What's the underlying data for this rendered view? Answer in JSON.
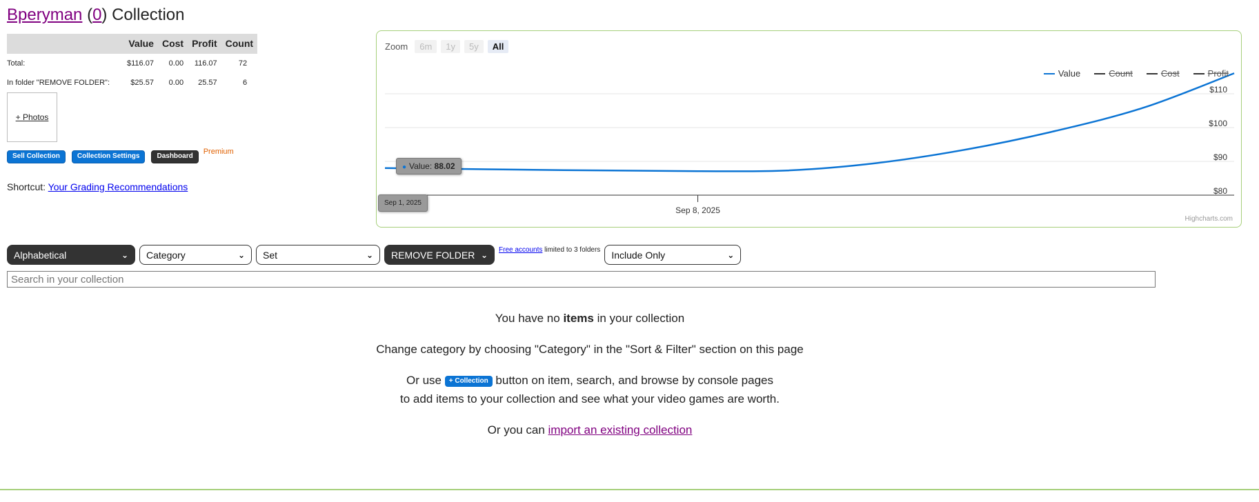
{
  "header": {
    "user": "Bperyman",
    "count": "0",
    "suffix": "Collection"
  },
  "summary": {
    "headers": [
      "",
      "Value",
      "Cost",
      "Profit",
      "Count"
    ],
    "rows": [
      {
        "label": "Total:",
        "value": "$116.07",
        "cost": "0.00",
        "profit": "116.07",
        "count": "72"
      },
      {
        "label": "In folder \"REMOVE FOLDER\":",
        "value": "$25.57",
        "cost": "0.00",
        "profit": "25.57",
        "count": "6"
      }
    ]
  },
  "photos_label": "+ Photos",
  "buttons": {
    "sell": "Sell Collection",
    "settings": "Collection Settings",
    "dashboard": "Dashboard",
    "premium": "Premium"
  },
  "shortcut": {
    "prefix": "Shortcut:",
    "link": "Your Grading Recommendations"
  },
  "chart_data": {
    "type": "line",
    "zoom": {
      "label": "Zoom",
      "options": [
        "6m",
        "1y",
        "5y",
        "All"
      ],
      "selected": "All"
    },
    "legend": [
      {
        "name": "Value",
        "visible": true
      },
      {
        "name": "Count",
        "visible": false
      },
      {
        "name": "Cost",
        "visible": false
      },
      {
        "name": "Profit",
        "visible": false
      }
    ],
    "y_ticks": [
      "$110",
      "$100",
      "$90",
      "$80"
    ],
    "ylim": [
      80,
      120
    ],
    "x_ticks": [
      "Sep 8, 2025"
    ],
    "series": [
      {
        "name": "Value",
        "color": "#0b74d4",
        "points": [
          {
            "x": "2025-09-01",
            "y": 88.02
          },
          {
            "x": "2025-09-05",
            "y": 87.4
          },
          {
            "x": "2025-09-08",
            "y": 87.1
          },
          {
            "x": "2025-09-10",
            "y": 87.3
          },
          {
            "x": "2025-09-12",
            "y": 89.5
          },
          {
            "x": "2025-09-14",
            "y": 93.5
          },
          {
            "x": "2025-09-16",
            "y": 99.0
          },
          {
            "x": "2025-09-18",
            "y": 106.0
          },
          {
            "x": "2025-09-20",
            "y": 116.07
          }
        ]
      }
    ],
    "tooltip": {
      "label": "Value:",
      "value": "88.02",
      "date": "Sep 1, 2025"
    },
    "credits": "Highcharts.com"
  },
  "filters": {
    "sort": "Alphabetical",
    "category": "Category",
    "set": "Set",
    "folder": "REMOVE FOLDER",
    "limit_link": "Free accounts",
    "limit_text": "limited to 3 folders",
    "include": "Include Only"
  },
  "search": {
    "placeholder": "Search in your collection"
  },
  "empty": {
    "line1_pre": "You have no",
    "line1_bold": "items",
    "line1_post": "in your collection",
    "line2": "Change category by choosing \"Category\" in the \"Sort & Filter\" section on this page",
    "line3_pre": "Or use",
    "line3_pill": "+ Collection",
    "line3_post": "button on item, search, and browse by console pages",
    "line4": "to add items to your collection and see what your video games are worth.",
    "line5_pre": "Or you can",
    "line5_link": "import an existing collection"
  }
}
